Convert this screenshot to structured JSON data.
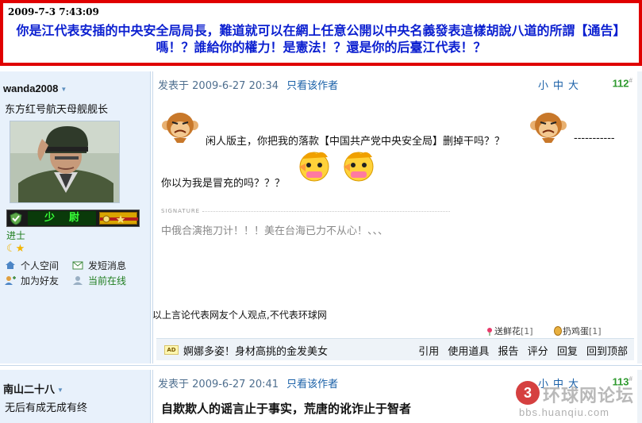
{
  "banner": {
    "timestamp": "2009-7-3 7:43:09",
    "text": "你是江代表安插的中央安全局局長，難道就可以在網上任意公開以中央名義發表這樣胡說八道的所謂【通告】嗎！？誰給你的權力！是憲法！？還是你的后臺江代表！？"
  },
  "post1": {
    "user": {
      "name": "wanda2008",
      "title": "东方红号航天母舰舰长",
      "rank_label": "少尉",
      "rank_level": "进士",
      "stars": "☾★",
      "actions": [
        "个人空间",
        "发短消息",
        "加为好友",
        "当前在线"
      ]
    },
    "meta": {
      "posted_label": "发表于",
      "datetime": "2009-6-27 20:34",
      "author_only": "只看该作者",
      "font_sizes": "小中大",
      "floor": "112",
      "floor_mark": "#"
    },
    "body": {
      "line1": "闲人版主，你把我的落款【中国共产党中央安全局】删掉干吗？？",
      "line1_tail": "-----------",
      "line2": "你以为我是冒充的吗？？？",
      "signature_label": "SIGNATURE",
      "signature": "中俄合演拖刀计！！！美在台海已力不从心！、、、"
    },
    "disclaimer": "以上言论代表网友个人观点,不代表环球网",
    "gifts": {
      "flower_label": "送鲜花",
      "flower_count": "[1]",
      "egg_label": "扔鸡蛋",
      "egg_count": "[1]"
    },
    "footer": {
      "ad_tag": "AD",
      "ad_text": "婀娜多姿！身材高挑的金发美女",
      "tools": [
        "引用",
        "使用道具",
        "报告",
        "评分",
        "回复",
        "回到顶部"
      ]
    }
  },
  "post2": {
    "user": {
      "name": "南山二十八",
      "title": "无后有成无成有终"
    },
    "meta": {
      "posted_label": "发表于",
      "datetime": "2009-6-27 20:41",
      "author_only": "只看该作者",
      "font_sizes": "小中大",
      "floor": "113",
      "floor_mark": "#"
    },
    "title": "自欺欺人的谣言止于事实，荒唐的讹诈止于智者"
  },
  "watermark": {
    "logo": "3",
    "title": "环球网论坛",
    "url": "bbs.huanqiu.com"
  },
  "colors": {
    "banner_border": "#e00000",
    "banner_text": "#0b1fd0",
    "sidebar_bg": "#e8f1fb",
    "floor_green": "#2f9a2f",
    "link_blue": "#1b61a8"
  }
}
